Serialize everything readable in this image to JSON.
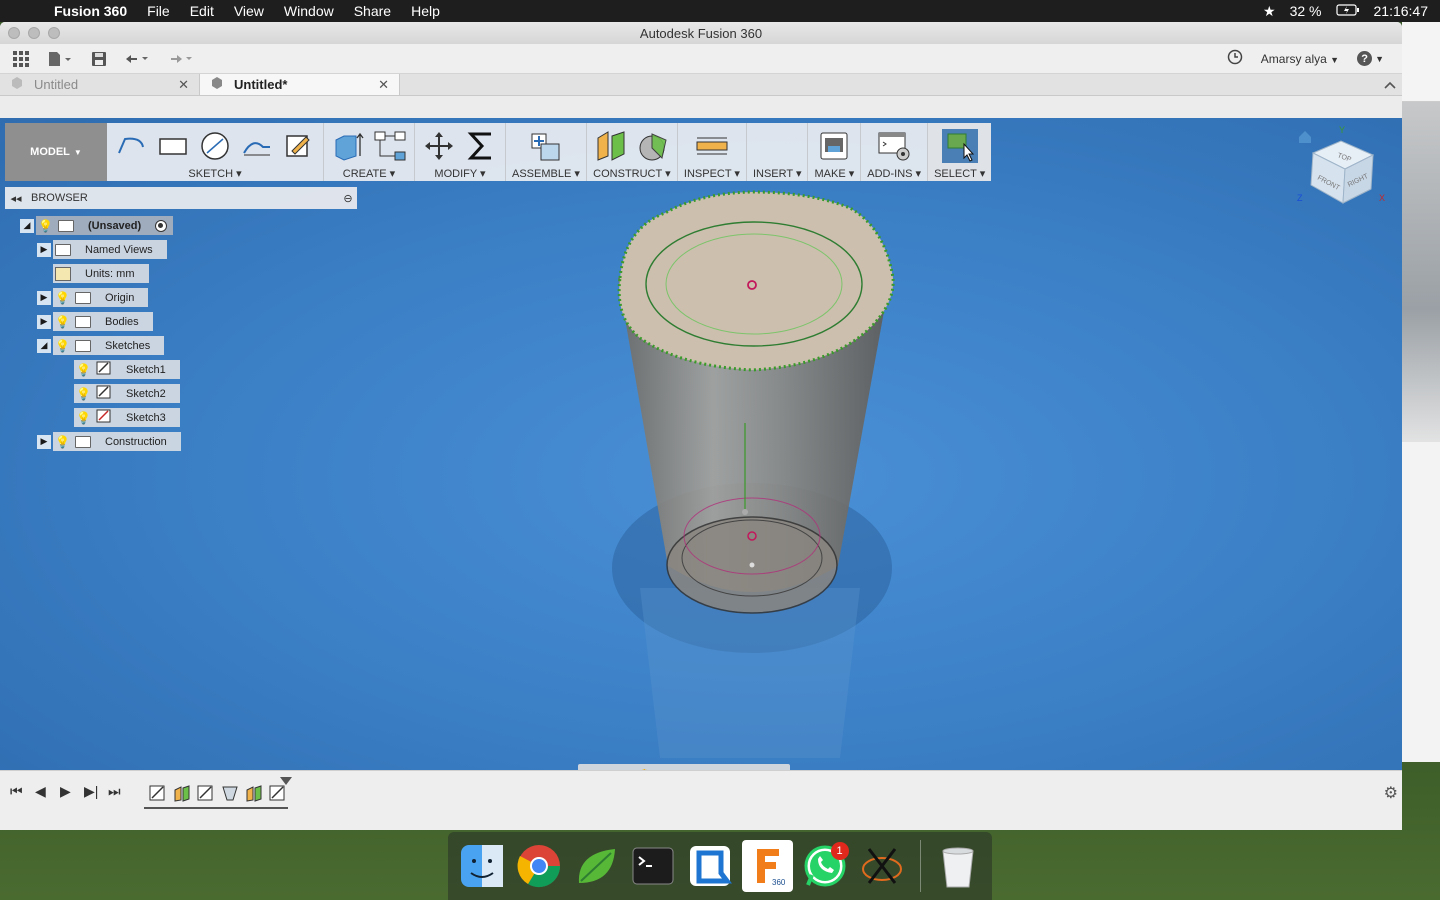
{
  "menubar": {
    "app": "Fusion 360",
    "items": [
      "File",
      "Edit",
      "View",
      "Window",
      "Share",
      "Help"
    ],
    "battery": "32 %",
    "clock": "21:16:47"
  },
  "window": {
    "title": "Autodesk Fusion 360"
  },
  "appbar": {
    "user": "Amarsy alya",
    "user_caret": "▼",
    "help": "?"
  },
  "tabs": [
    {
      "label": "Untitled",
      "close": "✕"
    },
    {
      "label": "Untitled*",
      "close": "✕"
    }
  ],
  "toolbar": {
    "mode": "MODEL",
    "groups": [
      "SKETCH",
      "CREATE",
      "MODIFY",
      "ASSEMBLE",
      "CONSTRUCT",
      "INSPECT",
      "INSERT",
      "MAKE",
      "ADD-INS",
      "SELECT"
    ]
  },
  "browser": {
    "title": "BROWSER",
    "root": "(Unsaved)",
    "items": [
      "Named Views",
      "Units: mm",
      "Origin",
      "Bodies",
      "Sketches",
      "Sketch1",
      "Sketch2",
      "Sketch3",
      "Construction"
    ]
  },
  "viewcube": {
    "top": "TOP",
    "front": "FRONT",
    "right": "RIGHT",
    "axis_y": "Y",
    "axis_z": "Z",
    "axis_x": "X"
  },
  "dock": {
    "whatsapp_badge": "1",
    "fusion_label": "360"
  },
  "colors": {
    "viewport": "#3d82c8",
    "toolbar_bg": "#ebeef2",
    "mode_bg": "#8f8f8f",
    "bulb": "#f0c419",
    "sketch_green": "#3a9a2a"
  }
}
